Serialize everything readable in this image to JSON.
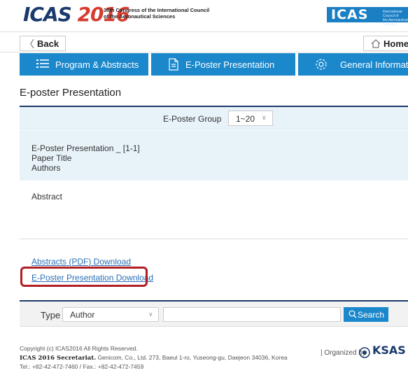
{
  "header": {
    "logo_text": "ICAS",
    "logo_year": "2016",
    "logo_line1": "30th Congress of the International Council",
    "logo_line2": "of the Aeronautical Sciences",
    "badge_big": "ICAS",
    "badge_small1": "International Council of",
    "badge_small2": "the Aeronautical Sciences"
  },
  "nav": {
    "back_label": "Back",
    "home_label": "Home"
  },
  "tabs": [
    {
      "label": "Program & Abstracts",
      "icon": "list-icon"
    },
    {
      "label": "E-Poster Presentation",
      "icon": "document-icon"
    },
    {
      "label": "General Information",
      "icon": "gear-icon"
    }
  ],
  "main": {
    "page_title": "E-poster Presentation",
    "group_label": "E-Poster Group",
    "group_value": "1~20",
    "paper": {
      "presentation": "E-Poster Presentation _ [1-1]",
      "title": "Paper Title",
      "authors": "Authors"
    },
    "abstract_label": "Abstract",
    "links": {
      "abstracts_pdf": "Abstracts (PDF) Download",
      "eposter_download": "E-Poster Presentation Download"
    }
  },
  "search": {
    "type_label": "Type",
    "type_value": "Author",
    "input_value": "",
    "button_label": "Search"
  },
  "footer": {
    "copyright": "Copyright (c) ICAS2016 All Rights Reserved.",
    "secretariat_bold": "ICAS 2016 Secretariat.",
    "secretariat_text": " Genicom, Co., Ltd. 273, Baeul 1-ro, Yuseong-gu, Daejeon 34036, Korea",
    "contact": "Tel.: +82-42-472-7460 / Fax.: +82-42-472-7459",
    "organized_by": "| Organized by",
    "org_name": "KSAS"
  },
  "colors": {
    "tab_blue": "#1b88cc",
    "navy": "#1a3a6b",
    "highlight_red": "#b01f24",
    "panel_bg": "#e8f3f9"
  }
}
